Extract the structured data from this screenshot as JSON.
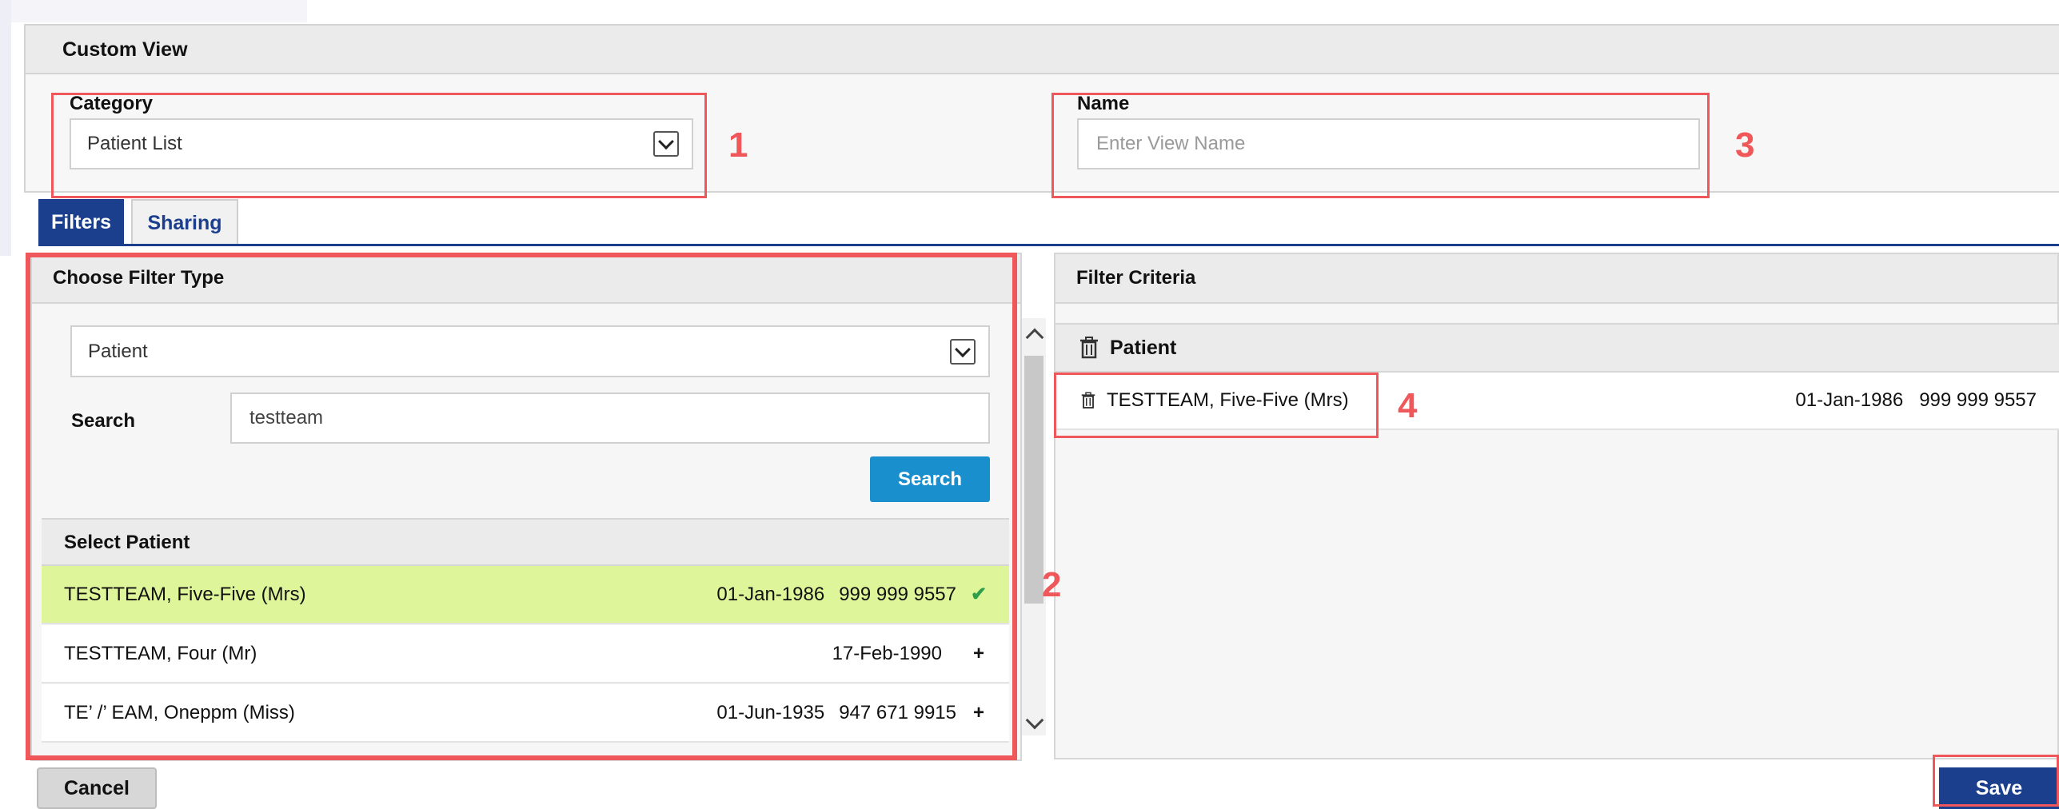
{
  "custom_view": {
    "title": "Custom View",
    "category_label": "Category",
    "category_value": "Patient List",
    "name_label": "Name",
    "name_placeholder": "Enter View Name"
  },
  "tabs": [
    {
      "label": "Filters",
      "active": true
    },
    {
      "label": "Sharing",
      "active": false
    }
  ],
  "filter_type_panel": {
    "title": "Choose Filter Type",
    "filter_type_value": "Patient",
    "search_label": "Search",
    "search_value": "testteam",
    "search_button": "Search",
    "select_title": "Select Patient",
    "patients": [
      {
        "name": "TESTTEAM, Five-Five (Mrs)",
        "dob": "01-Jan-1986",
        "nhs": "999 999 9557",
        "mark": "✔",
        "selected": true
      },
      {
        "name": "TESTTEAM, Four (Mr)",
        "dob": "17-Feb-1990",
        "nhs": "",
        "mark": "+",
        "selected": false
      },
      {
        "name": "TE’ /’ EAM, Oneppm (Miss)",
        "dob": "01-Jun-1935",
        "nhs": "947 671 9915",
        "mark": "+",
        "selected": false
      }
    ]
  },
  "filter_criteria": {
    "title": "Filter Criteria",
    "group_label": "Patient",
    "item": {
      "name": "TESTTEAM, Five-Five (Mrs)",
      "dob": "01-Jan-1986",
      "nhs": "999 999 9557"
    }
  },
  "buttons": {
    "cancel": "Cancel",
    "save": "Save"
  },
  "annotations": [
    "1",
    "2",
    "3",
    "4"
  ],
  "colors": {
    "accent": "#1b3f8c",
    "search_button": "#1a8fce",
    "selected_row": "#dff59a",
    "annotation": "#f0575b"
  }
}
